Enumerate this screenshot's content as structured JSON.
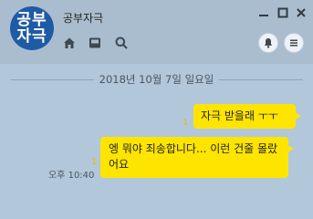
{
  "header": {
    "avatar_line1": "공부",
    "avatar_line2": "자극",
    "room_name": "공부자극",
    "avatar_color": "#1f5aa5"
  },
  "toolbar_icons": [
    "home-icon",
    "inbox-icon",
    "search-icon"
  ],
  "window_controls": [
    "minimize-icon",
    "maximize-icon",
    "close-icon"
  ],
  "right_buttons": [
    "bell-icon",
    "menu-icon"
  ],
  "chat": {
    "date_divider": "2018년 10월 7일 일요일",
    "messages": [
      {
        "text": "자극 받을래 ㅜㅜ",
        "read_count": "1"
      },
      {
        "text": "엥 뭐야 죄송합니다... 이런 건줄 몰랐어요",
        "read_count": "1",
        "time": "오후 10:40"
      }
    ]
  },
  "colors": {
    "background": "#b2c7d9",
    "bubble": "#fee500"
  }
}
